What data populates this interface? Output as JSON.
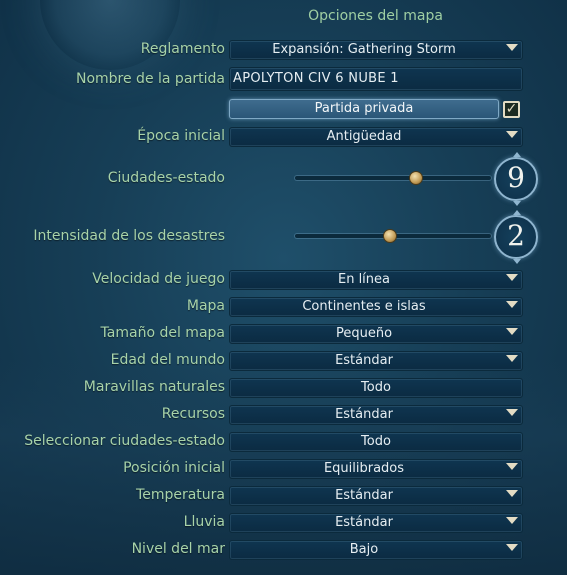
{
  "title": "Opciones del mapa",
  "rules": {
    "label": "Reglamento",
    "value": "Expansión: Gathering Storm"
  },
  "game_name": {
    "label": "Nombre de la partida",
    "value": "APOLYTON CIV 6 NUBE 1"
  },
  "private_game": {
    "label": "Partida privada",
    "checked": true
  },
  "start_era": {
    "label": "Época inicial",
    "value": "Antigüedad"
  },
  "city_states": {
    "label": "Ciudades-estado",
    "value": "9",
    "slider_fraction": 0.61
  },
  "disaster_intensity": {
    "label": "Intensidad de los desastres",
    "value": "2",
    "slider_fraction": 0.48
  },
  "game_speed": {
    "label": "Velocidad de juego",
    "value": "En línea"
  },
  "map": {
    "label": "Mapa",
    "value": "Continentes e islas"
  },
  "map_size": {
    "label": "Tamaño del mapa",
    "value": "Pequeño"
  },
  "world_age": {
    "label": "Edad del mundo",
    "value": "Estándar"
  },
  "natural_wonders": {
    "label": "Maravillas naturales",
    "value": "Todo"
  },
  "resources": {
    "label": "Recursos",
    "value": "Estándar"
  },
  "select_city_states": {
    "label": "Seleccionar ciudades-estado",
    "value": "Todo"
  },
  "start_position": {
    "label": "Posición inicial",
    "value": "Equilibrados"
  },
  "temperature": {
    "label": "Temperatura",
    "value": "Estándar"
  },
  "rainfall": {
    "label": "Lluvia",
    "value": "Estándar"
  },
  "sea_level": {
    "label": "Nivel del mar",
    "value": "Bajo"
  },
  "checkbox_glyph": "✓",
  "colors": {
    "label": "#a8d3a9",
    "background": "#173f57",
    "accent": "#e3dcc4"
  }
}
